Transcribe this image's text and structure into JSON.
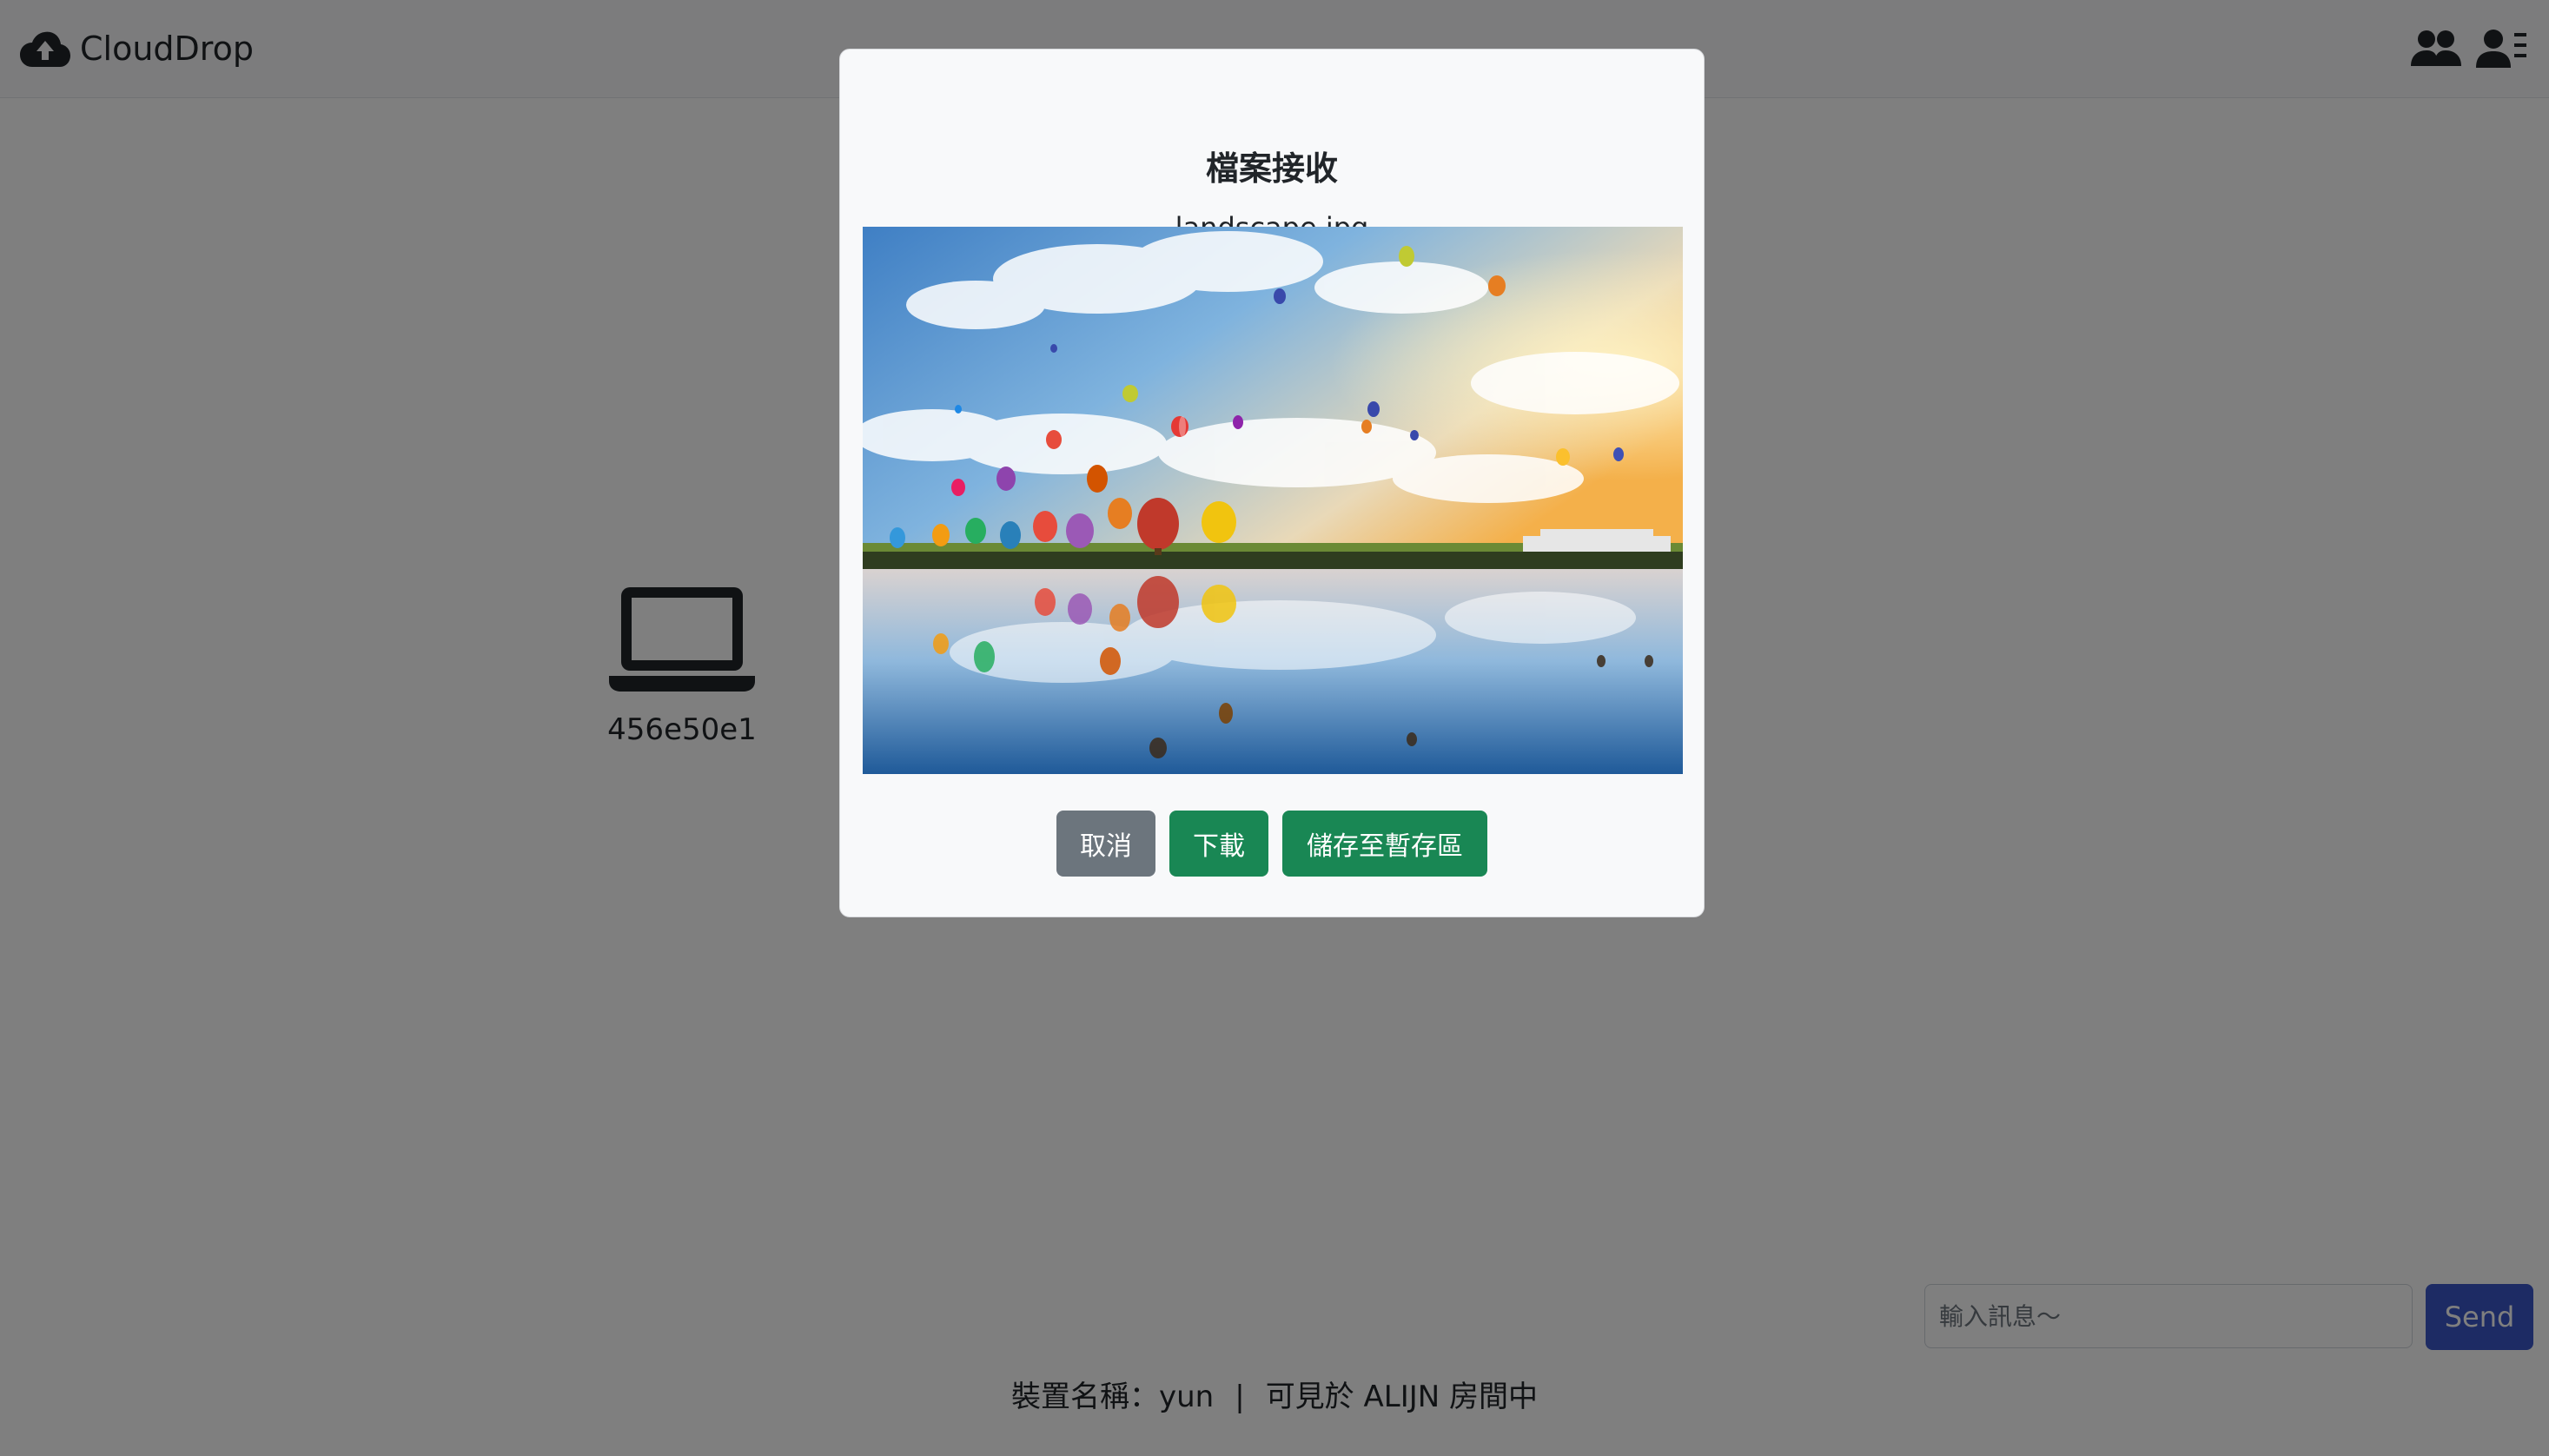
{
  "app": {
    "title": "CloudDrop"
  },
  "navbar": {
    "icons": [
      "people-icon",
      "user-list-icon"
    ]
  },
  "device": {
    "name": "456e50e1",
    "icon": "laptop-icon"
  },
  "chat": {
    "placeholder": "輸入訊息～",
    "send_label": "Send"
  },
  "footer": {
    "device_label": "裝置名稱：yun",
    "separator": "|",
    "visibility": "可見於 ALIJN 房間中"
  },
  "modal": {
    "title": "檔案接收",
    "filename": "landscape.jpg",
    "buttons": {
      "cancel": "取消",
      "download": "下載",
      "save": "儲存至暫存區"
    }
  },
  "colors": {
    "primary": "#3a57c9",
    "success": "#198754",
    "secondary": "#6c757d",
    "backdrop": "rgba(0,0,0,0.5)"
  }
}
